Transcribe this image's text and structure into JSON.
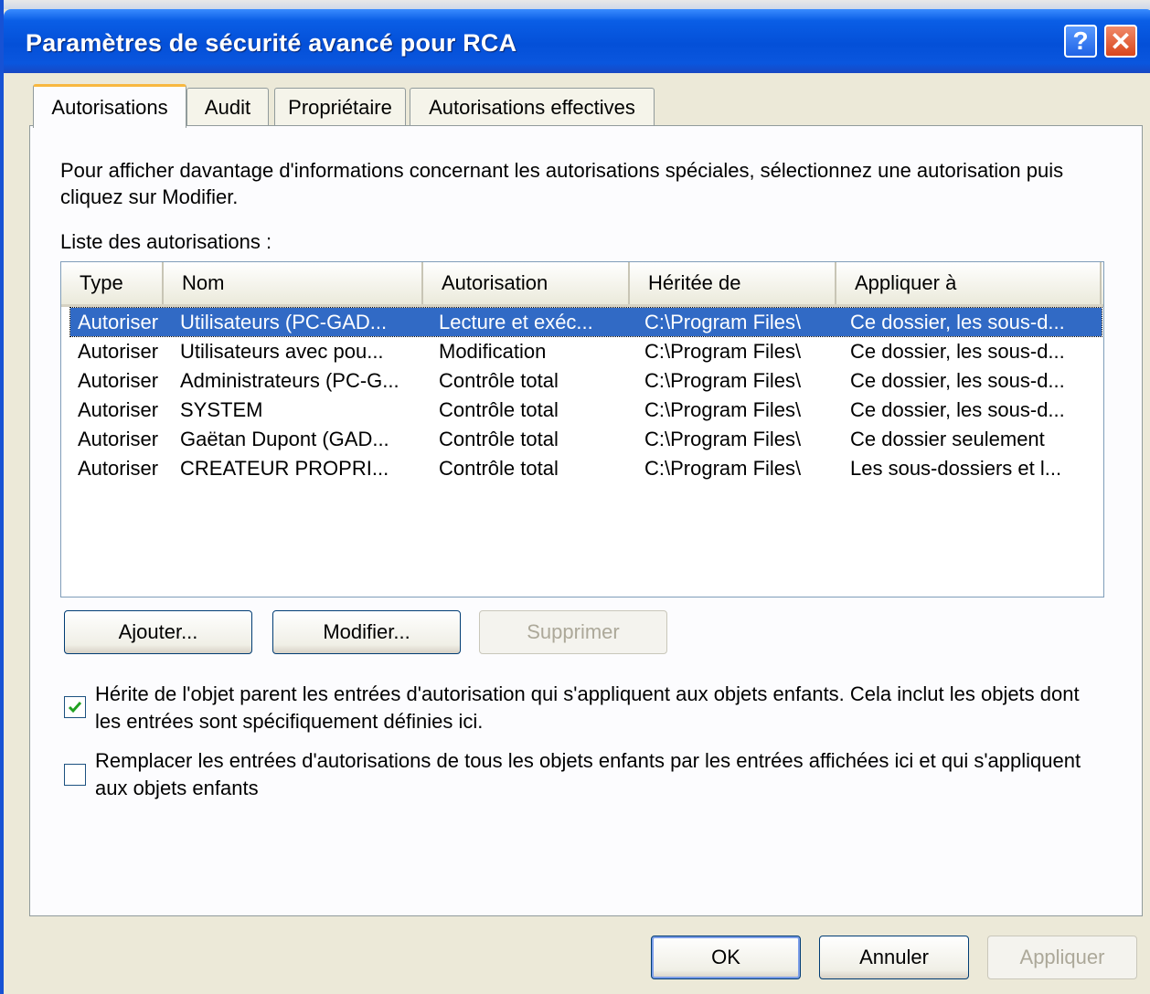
{
  "window": {
    "title": "Paramètres de sécurité avancé pour RCA",
    "help_glyph": "?",
    "close_glyph": "✕"
  },
  "tabs": [
    {
      "label": "Autorisations",
      "active": true
    },
    {
      "label": "Audit",
      "active": false
    },
    {
      "label": "Propriétaire",
      "active": false
    },
    {
      "label": "Autorisations effectives",
      "active": false
    }
  ],
  "panel": {
    "description": "Pour afficher davantage d'informations concernant les autorisations spéciales, sélectionnez une autorisation puis cliquez sur Modifier.",
    "list_label": "Liste des autorisations :"
  },
  "list": {
    "columns": [
      "Type",
      "Nom",
      "Autorisation",
      "Héritée de",
      "Appliquer à"
    ],
    "rows": [
      {
        "type": "Autoriser",
        "nom": "Utilisateurs (PC-GAD...",
        "autorisation": "Lecture et exéc...",
        "heritee": "C:\\Program Files\\",
        "appliquer": "Ce dossier, les sous-d...",
        "selected": true
      },
      {
        "type": "Autoriser",
        "nom": "Utilisateurs avec pou...",
        "autorisation": "Modification",
        "heritee": "C:\\Program Files\\",
        "appliquer": "Ce dossier, les sous-d...",
        "selected": false
      },
      {
        "type": "Autoriser",
        "nom": "Administrateurs (PC-G...",
        "autorisation": "Contrôle total",
        "heritee": "C:\\Program Files\\",
        "appliquer": "Ce dossier, les sous-d...",
        "selected": false
      },
      {
        "type": "Autoriser",
        "nom": "SYSTEM",
        "autorisation": "Contrôle total",
        "heritee": "C:\\Program Files\\",
        "appliquer": "Ce dossier, les sous-d...",
        "selected": false
      },
      {
        "type": "Autoriser",
        "nom": "Gaëtan Dupont (GAD...",
        "autorisation": "Contrôle total",
        "heritee": "C:\\Program Files\\",
        "appliquer": "Ce dossier seulement",
        "selected": false
      },
      {
        "type": "Autoriser",
        "nom": "CREATEUR PROPRI...",
        "autorisation": "Contrôle total",
        "heritee": "C:\\Program Files\\",
        "appliquer": "Les sous-dossiers et l...",
        "selected": false
      }
    ]
  },
  "list_buttons": {
    "add": "Ajouter...",
    "modify": "Modifier...",
    "remove": "Supprimer"
  },
  "options": {
    "inherit_label": "Hérite de l'objet parent les entrées d'autorisation qui s'appliquent aux objets enfants. Cela inclut les objets dont les entrées sont spécifiquement définies ici.",
    "inherit_checked": true,
    "replace_label": "Remplacer les entrées d'autorisations de tous les objets enfants par les entrées affichées ici et qui s'appliquent aux objets enfants",
    "replace_checked": false
  },
  "dialog_buttons": {
    "ok": "OK",
    "cancel": "Annuler",
    "apply": "Appliquer"
  }
}
